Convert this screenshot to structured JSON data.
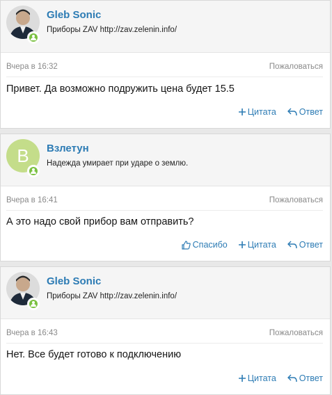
{
  "posts": [
    {
      "author": "Gleb Sonic",
      "status": "Приборы ZAV http://zav.zelenin.info/",
      "time": "Вчера в 16:32",
      "report": "Пожаловаться",
      "text": "Привет. Да возможно подружить цена будет 15.5",
      "quote": "Цитата",
      "reply": "Ответ"
    },
    {
      "author": "Взлетун",
      "avatar_letter": "B",
      "status": "Надежда умирает при ударе о землю.",
      "time": "Вчера в 16:41",
      "report": "Пожаловаться",
      "text": "А это надо свой прибор вам отправить?",
      "like": "Спасибо",
      "quote": "Цитата",
      "reply": "Ответ"
    },
    {
      "author": "Gleb Sonic",
      "status": "Приборы ZAV http://zav.zelenin.info/",
      "time": "Вчера в 16:43",
      "report": "Пожаловаться",
      "text": "Нет. Все будет готово к подключению",
      "quote": "Цитата",
      "reply": "Ответ"
    }
  ],
  "colors": {
    "link": "#2c7bb4",
    "online": "#7bc142",
    "avatar_bg": "#c4dd8a"
  },
  "icons": {
    "quote": "plus-icon",
    "reply": "reply-arrow-icon",
    "like": "thumbs-up-icon",
    "online": "online-status-icon"
  }
}
